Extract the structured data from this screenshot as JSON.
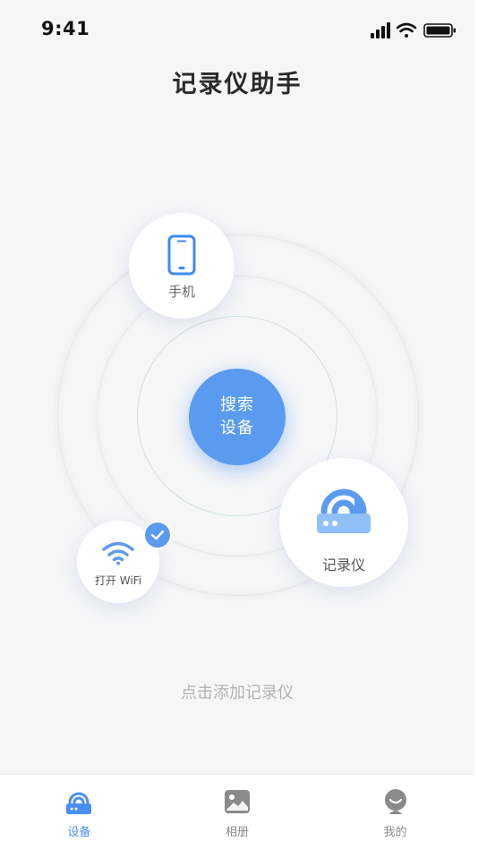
{
  "status_bar": {
    "time": "9:41"
  },
  "header": {
    "title": "记录仪助手"
  },
  "radar": {
    "center_button_line1": "搜索",
    "center_button_line2": "设备",
    "nodes": {
      "phone": {
        "label": "手机",
        "icon": "smartphone-icon"
      },
      "recorder": {
        "label": "记录仪",
        "icon": "router-icon"
      },
      "wifi": {
        "label": "打开 WiFi",
        "icon": "wifi-icon",
        "checked": true
      }
    }
  },
  "hint": {
    "text": "点击添加记录仪"
  },
  "tab_bar": {
    "items": [
      {
        "label": "设备",
        "icon": "device-icon",
        "active": true
      },
      {
        "label": "相册",
        "icon": "album-icon",
        "active": false
      },
      {
        "label": "我的",
        "icon": "profile-icon",
        "active": false
      }
    ]
  },
  "colors": {
    "accent": "#5b9bef",
    "accent_light": "#7cb4f5",
    "background": "#f6f6f7",
    "tab_inactive": "#8a8a8a"
  }
}
